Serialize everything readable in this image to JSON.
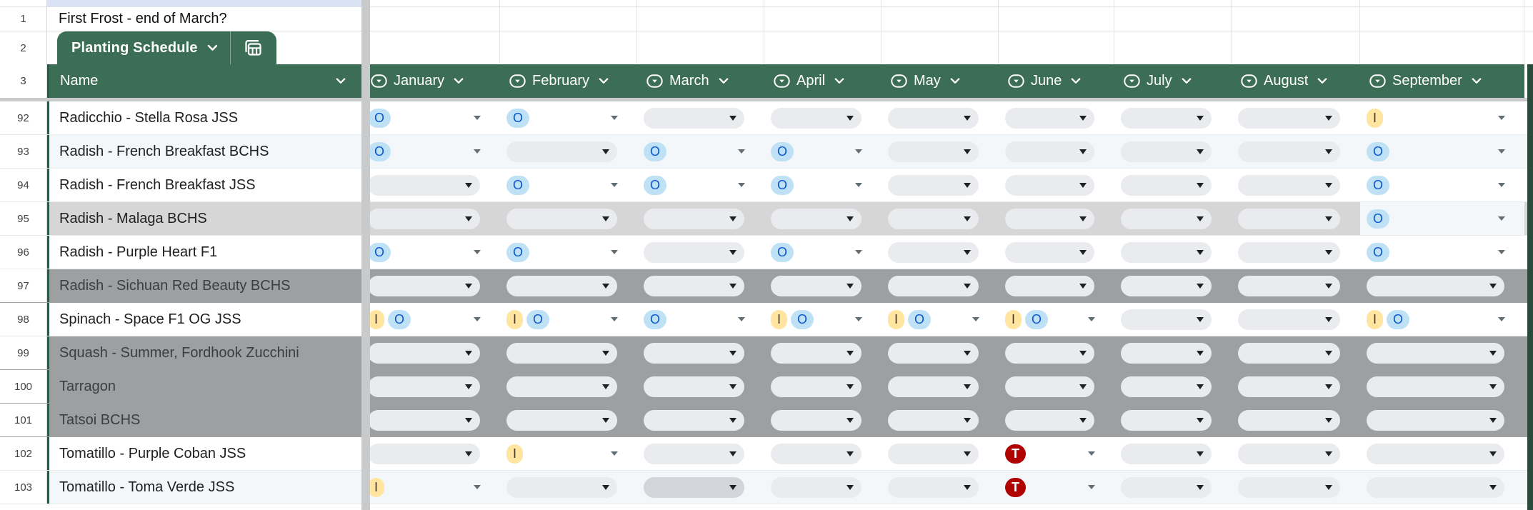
{
  "note_row": {
    "row_number": "1",
    "text": "First Frost - end of March?"
  },
  "tab_row": {
    "row_number": "2",
    "title": "Planting Schedule"
  },
  "header_row": {
    "row_number": "3",
    "name_label": "Name",
    "months": [
      "January",
      "February",
      "March",
      "April",
      "May",
      "June",
      "July",
      "August",
      "September"
    ]
  },
  "cell_codes": {
    "": "empty-dropdown-pill",
    "PD": "empty-dropdown-pill-darker",
    "O": "chip O",
    "I": "chip I",
    "T": "chip T",
    "IO": "chips I and O"
  },
  "chip_colors": {
    "O": {
      "bg": "#bfe1f6",
      "fg": "#0b57d0"
    },
    "I": {
      "bg": "#ffe5a0",
      "fg": "#473821"
    },
    "T": {
      "bg": "#b10202",
      "fg": "#ffffff"
    }
  },
  "theme": {
    "header_green": "#3c6e55",
    "table_border_green": "#2c5848",
    "frozen_divider_grey": "#c8cacb",
    "banded_row": "#f4f7fa",
    "selected_row_grey": "#d6d6d6",
    "dark_row_grey": "#9d9fa0",
    "pill_grey": "#e9ebee"
  },
  "rows": [
    {
      "row_number": "92",
      "name": "Radicchio - Stella Rosa JSS",
      "row_style": "white",
      "cells": [
        "O",
        "O",
        "",
        "",
        "",
        "",
        "",
        "",
        "I"
      ]
    },
    {
      "row_number": "93",
      "name": "Radish - French Breakfast BCHS",
      "row_style": "band",
      "cells": [
        "O",
        "",
        "O",
        "O",
        "",
        "",
        "",
        "",
        "O"
      ]
    },
    {
      "row_number": "94",
      "name": "Radish - French Breakfast JSS",
      "row_style": "white",
      "cells": [
        "",
        "O",
        "O",
        "O",
        "",
        "",
        "",
        "",
        "O"
      ]
    },
    {
      "row_number": "95",
      "name": "Radish - Malaga BCHS",
      "row_style": "selected",
      "september_unfilled": true,
      "cells": [
        "",
        "",
        "",
        "",
        "",
        "",
        "",
        "",
        "O"
      ]
    },
    {
      "row_number": "96",
      "name": "Radish - Purple Heart F1",
      "row_style": "white",
      "cells": [
        "O",
        "O",
        "",
        "O",
        "",
        "",
        "",
        "",
        "O"
      ]
    },
    {
      "row_number": "97",
      "name": "Radish - Sichuan Red Beauty BCHS",
      "row_style": "dark",
      "cells": [
        "",
        "",
        "",
        "",
        "",
        "",
        "",
        "",
        ""
      ]
    },
    {
      "row_number": "98",
      "name": "Spinach - Space F1 OG JSS",
      "row_style": "white",
      "cells": [
        "IO",
        "IO",
        "O",
        "IO",
        "IO",
        "IO",
        "",
        "",
        "IO"
      ]
    },
    {
      "row_number": "99",
      "name": "Squash - Summer, Fordhook Zucchini",
      "row_style": "dark",
      "cells": [
        "",
        "",
        "",
        "",
        "",
        "",
        "",
        "",
        ""
      ]
    },
    {
      "row_number": "100",
      "name": "Tarragon",
      "row_style": "dark",
      "cells": [
        "",
        "",
        "",
        "",
        "",
        "",
        "",
        "",
        ""
      ]
    },
    {
      "row_number": "101",
      "name": "Tatsoi BCHS",
      "row_style": "dark",
      "cells": [
        "",
        "",
        "",
        "",
        "",
        "",
        "",
        "",
        ""
      ]
    },
    {
      "row_number": "102",
      "name": "Tomatillo - Purple Coban JSS",
      "row_style": "white",
      "cells": [
        "",
        "I",
        "",
        "",
        "",
        "T",
        "",
        "",
        ""
      ]
    },
    {
      "row_number": "103",
      "name": "Tomatillo - Toma Verde JSS",
      "row_style": "band",
      "cells": [
        "I",
        "",
        "PD",
        "",
        "",
        "T",
        "",
        "",
        ""
      ]
    }
  ]
}
